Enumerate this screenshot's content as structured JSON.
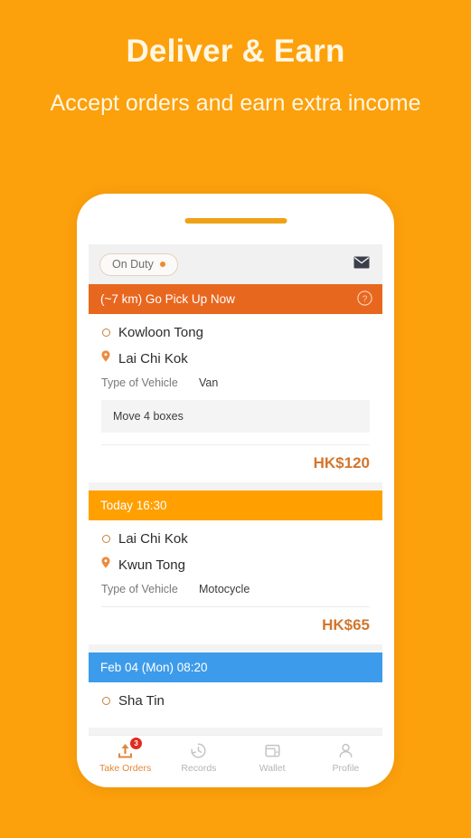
{
  "promo": {
    "title": "Deliver & Earn",
    "subtitle": "Accept orders and earn extra income"
  },
  "colors": {
    "background": "#FCA00C",
    "urgent_header": "#E8671F",
    "today_header": "#FFA000",
    "future_header": "#3D9BEB",
    "price": "#D2762E",
    "active_tab": "#E2883A",
    "badge": "#E02B20"
  },
  "app": {
    "status": {
      "duty_label": "On Duty",
      "duty_dot_icon": "status-dot-icon",
      "mail_icon": "envelope-icon"
    },
    "vehicle_label": "Type of Vehicle",
    "cards": [
      {
        "header": "(~7 km) Go Pick Up Now",
        "header_style": "urgent",
        "help_icon": "question-mark-circle-icon",
        "origin": "Kowloon Tong",
        "destination": "Lai Chi Kok",
        "vehicle_label": "Type of Vehicle",
        "vehicle": "Van",
        "note": "Move 4 boxes",
        "price": "HK$120"
      },
      {
        "header": "Today 16:30",
        "header_style": "today",
        "origin": "Lai Chi Kok",
        "destination": "Kwun Tong",
        "vehicle_label": "Type of Vehicle",
        "vehicle": "Motocycle",
        "price": "HK$65"
      },
      {
        "header": "Feb 04 (Mon) 08:20",
        "header_style": "future",
        "origin": "Sha Tin"
      }
    ],
    "tabs": [
      {
        "label": "Take Orders",
        "icon": "take-orders-icon",
        "active": true,
        "badge": "3"
      },
      {
        "label": "Records",
        "icon": "history-clock-icon",
        "active": false
      },
      {
        "label": "Wallet",
        "icon": "wallet-icon",
        "active": false
      },
      {
        "label": "Profile",
        "icon": "person-icon",
        "active": false
      }
    ]
  }
}
